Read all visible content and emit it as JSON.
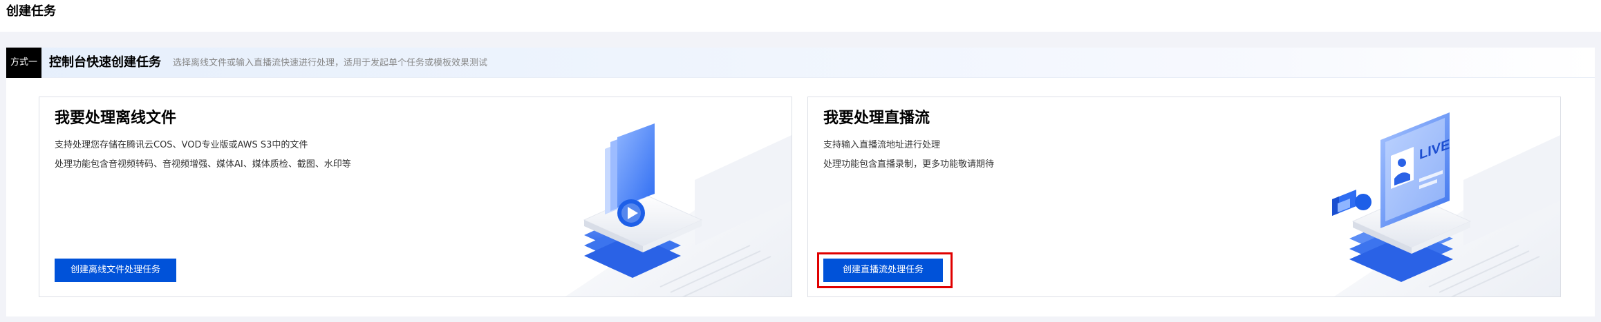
{
  "page": {
    "title": "创建任务"
  },
  "method": {
    "tag": "方式一",
    "title": "控制台快速创建任务",
    "description": "选择离线文件或输入直播流快速进行处理，适用于发起单个任务或模板效果测试"
  },
  "cards": [
    {
      "title": "我要处理离线文件",
      "line1": "支持处理您存储在腾讯云COS、VOD专业版或AWS S3中的文件",
      "line2": "处理功能包含音视频转码、音视频增强、媒体AI、媒体质检、截图、水印等",
      "button_label": "创建离线文件处理任务",
      "illustration_icon": "folder-play-icon"
    },
    {
      "title": "我要处理直播流",
      "line1": "支持输入直播流地址进行处理",
      "line2": "处理功能包含直播录制，更多功能敬请期待",
      "button_label": "创建直播流处理任务",
      "button_highlighted": true,
      "illustration_icon": "live-camera-icon",
      "illustration_text": "LIVE"
    }
  ],
  "colors": {
    "primary": "#0052d9",
    "highlight": "#e00000",
    "tag_bg": "#000000"
  }
}
